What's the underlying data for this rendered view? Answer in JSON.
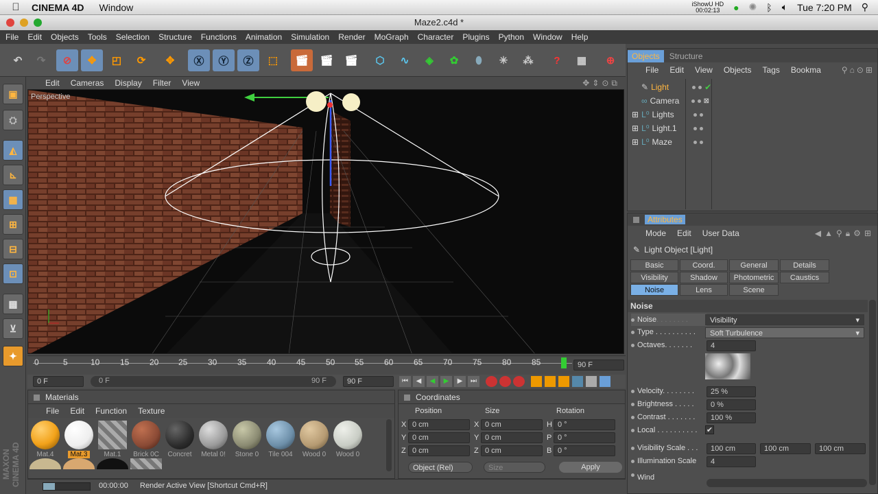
{
  "mac": {
    "app": "CINEMA 4D",
    "menu": [
      "Window"
    ],
    "time": "Tue 7:20 PM",
    "recorder": "iShowU HD",
    "rec_time": "00:02:13"
  },
  "window": {
    "title": "Maze2.c4d *"
  },
  "menu": [
    "File",
    "Edit",
    "Objects",
    "Tools",
    "Selection",
    "Structure",
    "Functions",
    "Animation",
    "Simulation",
    "Render",
    "MoGraph",
    "Character",
    "Plugins",
    "Python",
    "Window",
    "Help"
  ],
  "viewport": {
    "menu": [
      "Edit",
      "Cameras",
      "Display",
      "Filter",
      "View"
    ],
    "label": "Perspective"
  },
  "timeline": {
    "ticks": [
      "0",
      "5",
      "10",
      "15",
      "20",
      "25",
      "30",
      "35",
      "40",
      "45",
      "50",
      "55",
      "60",
      "65",
      "70",
      "75",
      "80",
      "85"
    ],
    "end_frame": "90 F",
    "start_field": "0 F",
    "slider_start": "0 F",
    "slider_end": "90 F",
    "end_field": "90 F"
  },
  "materials": {
    "title": "Materials",
    "menu": [
      "File",
      "Edit",
      "Function",
      "Texture"
    ],
    "items": [
      {
        "name": "Mat.4",
        "color": "#f2a21a"
      },
      {
        "name": "Mat.3",
        "color": "#f4f4f4",
        "selected": true
      },
      {
        "name": "Mat.1",
        "color": "stripe"
      },
      {
        "name": "Brick 0C",
        "color": "#8a4a35"
      },
      {
        "name": "Concret",
        "color": "#2c2c2c"
      },
      {
        "name": "Metal 0!",
        "color": "#9a9a9a"
      },
      {
        "name": "Stone 0",
        "color": "#8a8a72"
      },
      {
        "name": "Tile 004",
        "color": "#6c8ea8"
      },
      {
        "name": "Wood 0",
        "color": "#b59a72"
      },
      {
        "name": "Wood 0",
        "color": "#c8ccc4"
      }
    ]
  },
  "coordinates": {
    "title": "Coordinates",
    "headers": [
      "Position",
      "Size",
      "Rotation"
    ],
    "rows": [
      {
        "a": "X",
        "av": "0 cm",
        "b": "X",
        "bv": "0 cm",
        "c": "H",
        "cv": "0 °"
      },
      {
        "a": "Y",
        "av": "0 cm",
        "b": "Y",
        "bv": "0 cm",
        "c": "P",
        "cv": "0 °"
      },
      {
        "a": "Z",
        "av": "0 cm",
        "b": "Z",
        "bv": "0 cm",
        "c": "B",
        "cv": "0 °"
      }
    ],
    "mode": "Object (Rel)",
    "size_mode": "Size",
    "apply": "Apply"
  },
  "objects": {
    "tabs": [
      "Objects",
      "Structure"
    ],
    "menu": [
      "File",
      "Edit",
      "View",
      "Objects",
      "Tags",
      "Bookma"
    ],
    "items": [
      {
        "name": "Light",
        "selected": true
      },
      {
        "name": "Camera"
      },
      {
        "name": "Lights"
      },
      {
        "name": "Light.1"
      },
      {
        "name": "Maze"
      }
    ]
  },
  "attributes": {
    "title": "Attributes",
    "menu": [
      "Mode",
      "Edit",
      "User Data"
    ],
    "object": "Light Object [Light]",
    "tabs": [
      "Basic",
      "Coord.",
      "General",
      "Details",
      "Visibility",
      "Shadow",
      "Photometric",
      "Caustics",
      "Noise",
      "Lens",
      "Scene"
    ],
    "section": "Noise",
    "noise": {
      "label": "Noise",
      "value": "Visibility"
    },
    "type": {
      "label": "Type . . . . . . . . . .",
      "value": "Soft Turbulence"
    },
    "octaves": {
      "label": "Octaves. . . . . . .",
      "value": "4"
    },
    "velocity": {
      "label": "Velocity. . . . . . . .",
      "value": "25 %"
    },
    "brightness": {
      "label": "Brightness . . . . .",
      "value": "0 %"
    },
    "contrast": {
      "label": "Contrast . . . . . . .",
      "value": "100 %"
    },
    "local": {
      "label": "Local . . . . . . . . . ."
    },
    "vis_scale": {
      "label": "Visibility Scale . . .",
      "v1": "100 cm",
      "v2": "100 cm",
      "v3": "100 cm"
    },
    "illum_scale": {
      "label": "Illumination Scale",
      "value": "4"
    },
    "wind": {
      "label": "Wind"
    }
  },
  "status": {
    "time": "00:00:00",
    "text": "Render Active View [Shortcut Cmd+R]"
  },
  "brand": "MAXON CINEMA 4D"
}
